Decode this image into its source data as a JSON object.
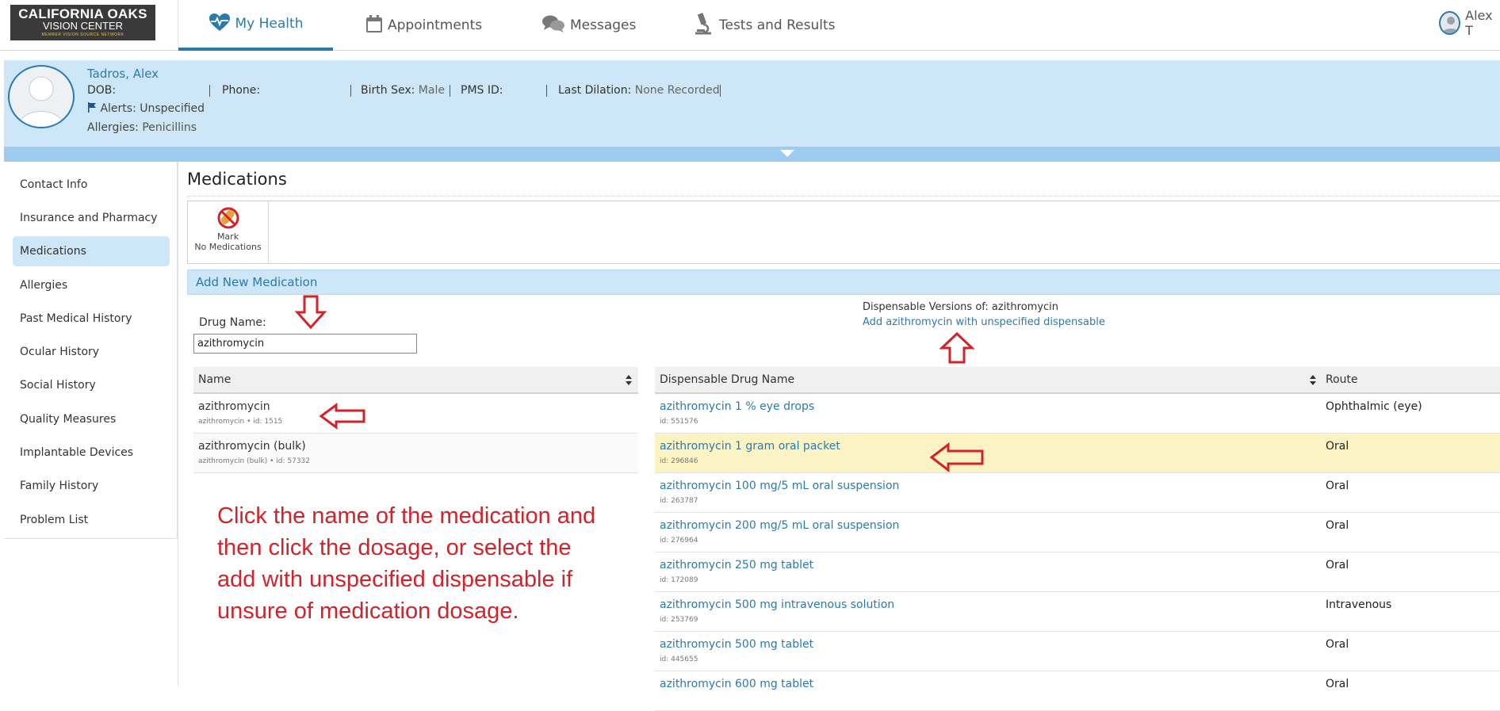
{
  "brand": {
    "line1": "CALIFORNIA OAKS",
    "line2": "VISION CENTER",
    "line3": "MEMBER VISION SOURCE NETWORK"
  },
  "nav": {
    "tabs": [
      {
        "label": "My Health",
        "icon": "heart-pulse-icon"
      },
      {
        "label": "Appointments",
        "icon": "calendar-icon"
      },
      {
        "label": "Messages",
        "icon": "chat-bubbles-icon"
      },
      {
        "label": "Tests and Results",
        "icon": "microscope-icon"
      }
    ],
    "user_name": "Alex T"
  },
  "patient": {
    "name": "Tadros, Alex",
    "dob_label": "DOB:",
    "dob_value": "",
    "phone_label": "Phone:",
    "phone_value": "",
    "birth_sex_label": "Birth Sex:",
    "birth_sex_value": "Male",
    "pms_label": "PMS ID:",
    "pms_value": "",
    "dilation_label": "Last Dilation:",
    "dilation_value": "None Recorded",
    "alerts": "Alerts: Unspecified",
    "allergies_label": "Allergies:",
    "allergies_value": "Penicillins"
  },
  "sidebar": {
    "items": [
      {
        "label": "Contact Info"
      },
      {
        "label": "Insurance and Pharmacy"
      },
      {
        "label": "Medications",
        "active": true
      },
      {
        "label": "Allergies"
      },
      {
        "label": "Past Medical History"
      },
      {
        "label": "Ocular History"
      },
      {
        "label": "Social History"
      },
      {
        "label": "Quality Measures"
      },
      {
        "label": "Implantable Devices"
      },
      {
        "label": "Family History"
      },
      {
        "label": "Problem List"
      }
    ]
  },
  "main": {
    "title": "Medications",
    "toolbar": {
      "mark_line1": "Mark",
      "mark_line2": "No Medications"
    },
    "add_header": "Add New Medication",
    "drug_name_label": "Drug Name:",
    "drug_name_value": "azithromycin",
    "dispensable_title": "Dispensable Versions of: azithromycin",
    "dispensable_link": "Add azithromycin with unspecified dispensable",
    "left_table": {
      "header": "Name",
      "rows": [
        {
          "name": "azithromycin",
          "sub": "azithromycin • id: 1515"
        },
        {
          "name": "azithromycin (bulk)",
          "sub": "azithromycin (bulk) • id: 57332"
        }
      ]
    },
    "right_table": {
      "header_name": "Dispensable Drug Name",
      "header_route": "Route",
      "rows": [
        {
          "name": "azithromycin 1 % eye drops",
          "id": "id: 551576",
          "route": "Ophthalmic (eye)"
        },
        {
          "name": "azithromycin 1 gram oral packet",
          "id": "id: 296846",
          "route": "Oral",
          "highlighted": true
        },
        {
          "name": "azithromycin 100 mg/5 mL oral suspension",
          "id": "id: 263787",
          "route": "Oral"
        },
        {
          "name": "azithromycin 200 mg/5 mL oral suspension",
          "id": "id: 276964",
          "route": "Oral"
        },
        {
          "name": "azithromycin 250 mg tablet",
          "id": "id: 172089",
          "route": "Oral"
        },
        {
          "name": "azithromycin 500 mg intravenous solution",
          "id": "id: 253769",
          "route": "Intravenous"
        },
        {
          "name": "azithromycin 500 mg tablet",
          "id": "id: 445655",
          "route": "Oral"
        },
        {
          "name": "azithromycin 600 mg tablet",
          "id": "",
          "route": "Oral"
        }
      ]
    },
    "instruction": "Click the name of the medication and then click the dosage, or select the add with unspecified dispensable if unsure of medication dosage."
  },
  "colors": {
    "accent": "#2a7ab0",
    "banner": "#cde6f8",
    "highlight_row": "#fcf3c4",
    "annotation": "#d4222a"
  }
}
